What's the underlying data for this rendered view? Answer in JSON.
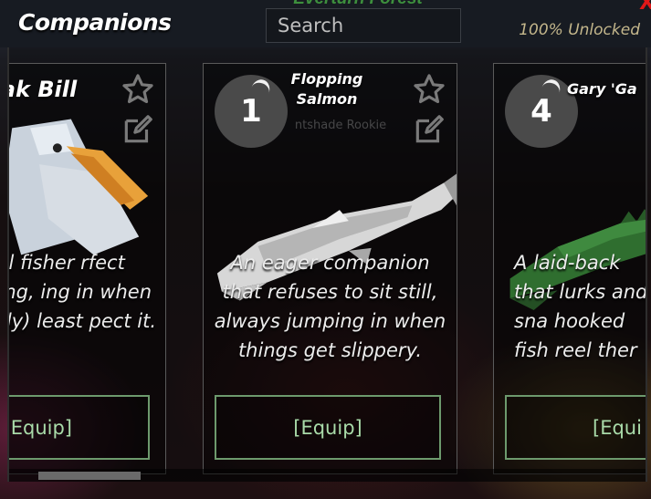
{
  "header": {
    "title": "Companions",
    "area_name": "Everturn Forest",
    "search_placeholder": "Search",
    "unlocked_text": "100% Unlocked",
    "close_label": "X"
  },
  "cards": [
    {
      "name": "ak Bill",
      "description": "chful fisher rfect timing, ing in when sually) least pect it.",
      "equip_label": "[Equip]"
    },
    {
      "name": "Flopping Salmon",
      "level": "1",
      "background_text": "ntshade Rookie",
      "description": "An eager companion that refuses to sit still, always jumping in when things get slippery.",
      "equip_label": "[Equip]"
    },
    {
      "name": "Gary 'Ga",
      "level": "4",
      "description": "A laid-back that lurks and sna hooked fish reel ther",
      "equip_label": "[Equi"
    }
  ],
  "icons": {
    "favorite": "star-outline-icon",
    "edit": "edit-pencil-icon"
  },
  "colors": {
    "accent_green": "#6d9a6d",
    "close_red": "#e01818",
    "unlocked_gold": "#c4b78c",
    "badge_gray": "#4a4a4a"
  },
  "scroll": {
    "position_fraction": 0.05
  }
}
